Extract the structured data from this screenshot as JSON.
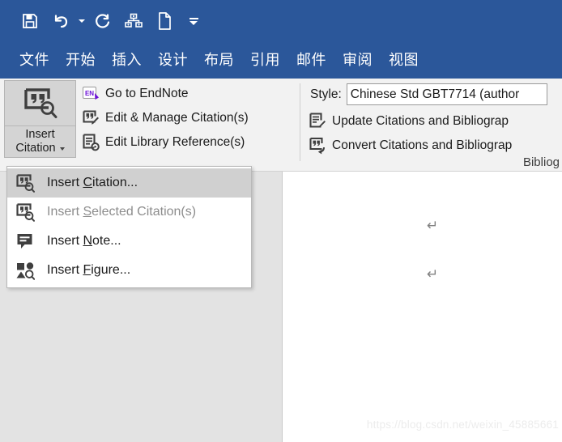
{
  "colors": {
    "brand_blue": "#2b579a",
    "ribbon_bg": "#f2f2f2",
    "menu_highlight": "#d0d0d0",
    "doc_bg": "#e3e3e3",
    "endnote_purple": "#6a0dd6"
  },
  "quick_access": {
    "items": [
      {
        "name": "save-icon",
        "label": "Save"
      },
      {
        "name": "undo-icon",
        "label": "Undo"
      },
      {
        "name": "undo-dropdown-caret",
        "label": "Undo options"
      },
      {
        "name": "redo-icon",
        "label": "Redo"
      },
      {
        "name": "smartart-hierarchy-icon",
        "label": "SmartArt"
      },
      {
        "name": "new-document-icon",
        "label": "New"
      },
      {
        "name": "customize-quick-access-toolbar-icon",
        "label": "Customize Quick Access Toolbar"
      }
    ]
  },
  "ribbon_tabs": [
    {
      "label": "文件"
    },
    {
      "label": "开始"
    },
    {
      "label": "插入"
    },
    {
      "label": "设计"
    },
    {
      "label": "布局"
    },
    {
      "label": "引用"
    },
    {
      "label": "邮件"
    },
    {
      "label": "审阅"
    },
    {
      "label": "视图"
    }
  ],
  "ribbon": {
    "insert_citation_button": {
      "line1": "Insert",
      "line2": "Citation"
    },
    "citations_commands": [
      {
        "icon": "endnote-icon",
        "label": "Go to EndNote"
      },
      {
        "icon": "edit-citation-icon",
        "label": "Edit & Manage Citation(s)"
      },
      {
        "icon": "edit-library-reference-icon",
        "label": "Edit Library Reference(s)"
      }
    ],
    "style": {
      "label": "Style:",
      "value": "Chinese Std GBT7714 (author"
    },
    "bibliography_commands": [
      {
        "icon": "update-bibliography-icon",
        "label": "Update Citations and Bibliograp"
      },
      {
        "icon": "convert-bibliography-icon",
        "label": "Convert Citations and Bibliograp"
      }
    ],
    "group_label_bibliography": "Bibliog"
  },
  "insert_citation_menu": {
    "items": [
      {
        "icon": "insert-citation-icon",
        "pre": "Insert ",
        "mnemonic": "C",
        "post": "itation...",
        "selected": true,
        "disabled": false
      },
      {
        "icon": "insert-selected-citation-icon",
        "pre": "Insert ",
        "mnemonic": "S",
        "post": "elected Citation(s)",
        "selected": false,
        "disabled": true
      },
      {
        "icon": "insert-note-icon",
        "pre": "Insert ",
        "mnemonic": "N",
        "post": "ote...",
        "selected": false,
        "disabled": false
      },
      {
        "icon": "insert-figure-icon",
        "pre": "Insert ",
        "mnemonic": "F",
        "post": "igure...",
        "selected": false,
        "disabled": false
      }
    ]
  },
  "document": {
    "paragraph_marks": [
      {
        "glyph": "↵"
      },
      {
        "glyph": "↵"
      }
    ],
    "watermark": "https://blog.csdn.net/weixin_45885661"
  }
}
